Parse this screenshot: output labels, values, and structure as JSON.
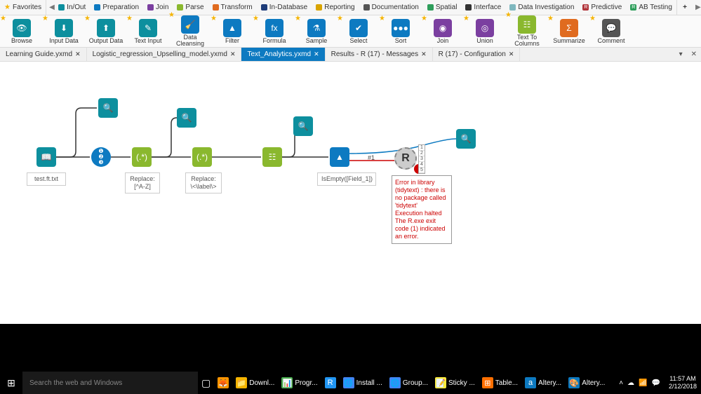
{
  "favorites_label": "Favorites",
  "categories": [
    {
      "label": "In/Out",
      "color": "#0d8f9e"
    },
    {
      "label": "Preparation",
      "color": "#0d7ac1"
    },
    {
      "label": "Join",
      "color": "#7b3fa0"
    },
    {
      "label": "Parse",
      "color": "#8ab82e"
    },
    {
      "label": "Transform",
      "color": "#e06b1f"
    },
    {
      "label": "In-Database",
      "color": "#1f3d7a"
    },
    {
      "label": "Reporting",
      "color": "#d9a400"
    },
    {
      "label": "Documentation",
      "color": "#555"
    },
    {
      "label": "Spatial",
      "color": "#2e9e5b"
    },
    {
      "label": "Interface",
      "color": "#333"
    },
    {
      "label": "Data Investigation",
      "color": "#7fb8bf"
    },
    {
      "label": "Predictive",
      "color": "#b0343a",
      "badge": "R"
    },
    {
      "label": "AB Testing",
      "color": "#2e9e5b",
      "badge": "R"
    }
  ],
  "tools": [
    {
      "label": "Browse",
      "color": "#0d8f9e",
      "glyph": "👁"
    },
    {
      "label": "Input Data",
      "color": "#0d8f9e",
      "glyph": "⬇"
    },
    {
      "label": "Output Data",
      "color": "#0d8f9e",
      "glyph": "⬆"
    },
    {
      "label": "Text Input",
      "color": "#0d8f9e",
      "glyph": "✎"
    },
    {
      "label": "Data Cleansing",
      "color": "#0d7ac1",
      "glyph": "🧹"
    },
    {
      "label": "Filter",
      "color": "#0d7ac1",
      "glyph": "▲"
    },
    {
      "label": "Formula",
      "color": "#0d7ac1",
      "glyph": "fx"
    },
    {
      "label": "Sample",
      "color": "#0d7ac1",
      "glyph": "⚗"
    },
    {
      "label": "Select",
      "color": "#0d7ac1",
      "glyph": "✔"
    },
    {
      "label": "Sort",
      "color": "#0d7ac1",
      "glyph": "●●●"
    },
    {
      "label": "Join",
      "color": "#7b3fa0",
      "glyph": "◉"
    },
    {
      "label": "Union",
      "color": "#7b3fa0",
      "glyph": "◎"
    },
    {
      "label": "Text To Columns",
      "color": "#8ab82e",
      "glyph": "☷"
    },
    {
      "label": "Summarize",
      "color": "#e06b1f",
      "glyph": "Σ"
    },
    {
      "label": "Comment",
      "color": "#555",
      "glyph": "💬"
    }
  ],
  "doc_tabs": [
    {
      "label": "Learning Guide.yxmd",
      "active": false
    },
    {
      "label": "Logistic_regression_Upselling_model.yxmd",
      "active": false
    },
    {
      "label": "Text_Analytics.yxmd",
      "active": true
    },
    {
      "label": "Results - R (17) - Messages",
      "active": false
    },
    {
      "label": "R (17) - Configuration",
      "active": false
    }
  ],
  "canvas": {
    "input_label": "test.ft.txt",
    "regex1_label": "Replace:\n[^A-Z]",
    "regex2_label": "Replace:\n\\<\\label\\>",
    "filter_label": "IsEmpty([Field_1])",
    "conn_label": "#1",
    "num_ports": [
      "1",
      "2",
      "3",
      "4",
      "5"
    ],
    "error_text": "Error in library (tidytext) : there is no package called 'tidytext'\nExecution halted\nThe R.exe exit code (1) indicated an error."
  },
  "taskbar": {
    "search_placeholder": "Search the web and Windows",
    "items": [
      {
        "label": "",
        "icon": "🦊",
        "color": "#ff9500"
      },
      {
        "label": "Downl...",
        "icon": "📁",
        "color": "#f5b400"
      },
      {
        "label": "Progr...",
        "icon": "📊",
        "color": "#4caf50"
      },
      {
        "label": "",
        "icon": "R",
        "color": "#2196f3"
      },
      {
        "label": "Install ...",
        "icon": "🌐",
        "color": "#4285f4"
      },
      {
        "label": "Group...",
        "icon": "🌐",
        "color": "#4285f4"
      },
      {
        "label": "Sticky ...",
        "icon": "📝",
        "color": "#ffeb3b"
      },
      {
        "label": "Table...",
        "icon": "⊞",
        "color": "#ff6f00"
      },
      {
        "label": "Altery...",
        "icon": "a",
        "color": "#0d7ac1"
      },
      {
        "label": "Altery...",
        "icon": "🎨",
        "color": "#0d7ac1"
      }
    ],
    "time": "11:57 AM",
    "date": "2/12/2018"
  }
}
